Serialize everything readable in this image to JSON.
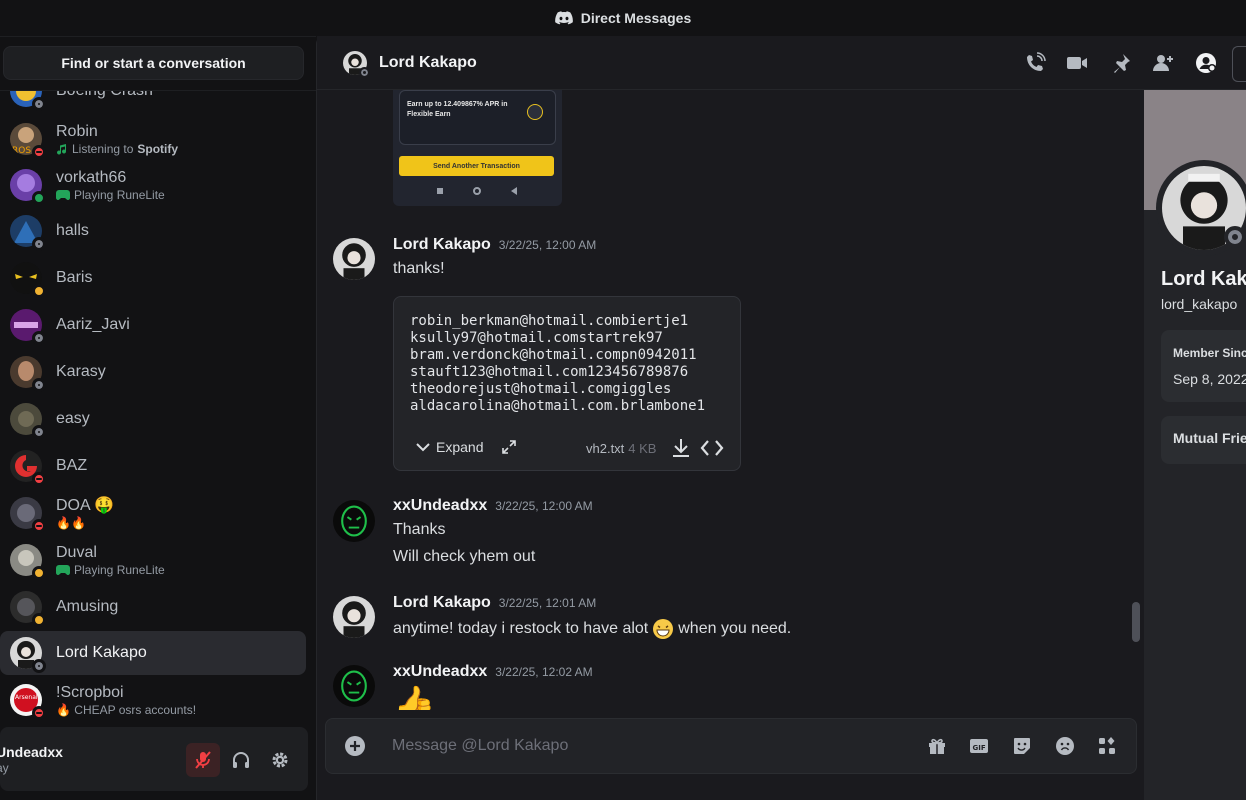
{
  "window": {
    "title": "Direct Messages"
  },
  "sidebar": {
    "search_label": "Find or start a conversation",
    "dms": [
      {
        "name": "Boeing Crash",
        "status": "offline",
        "sub": ""
      },
      {
        "name": "Robin",
        "status": "dnd",
        "sub_prefix": "Listening to",
        "sub": "Spotify",
        "sub_icon": "music-note-icon"
      },
      {
        "name": "vorkath66",
        "status": "online",
        "sub": "Playing RuneLite",
        "sub_icon": "gamepad-icon"
      },
      {
        "name": "halls",
        "status": "offline",
        "sub": ""
      },
      {
        "name": "Baris",
        "status": "idle",
        "sub": ""
      },
      {
        "name": "Aariz_Javi",
        "status": "offline",
        "sub": ""
      },
      {
        "name": "Karasy",
        "status": "offline",
        "sub": ""
      },
      {
        "name": "easy",
        "status": "offline",
        "sub": ""
      },
      {
        "name": "BAZ",
        "status": "dnd",
        "sub": ""
      },
      {
        "name": "DOA 🤑",
        "status": "dnd",
        "sub": "🔥🔥"
      },
      {
        "name": "Duval",
        "status": "idle",
        "sub": "Playing RuneLite",
        "sub_icon": "gamepad-icon"
      },
      {
        "name": "Amusing",
        "status": "idle",
        "sub": ""
      },
      {
        "name": "Lord Kakapo",
        "status": "offline",
        "sub": "",
        "selected": true
      },
      {
        "name": "!Scropboi",
        "status": "dnd",
        "sub": "🔥 CHEAP osrs accounts!"
      }
    ],
    "user_panel": {
      "name": "Undeadxx",
      "status": "ay"
    }
  },
  "chat": {
    "recipient": "Lord Kakapo",
    "image_attachment": {
      "text": "Earn up to 12.409867% APR in Flexible Earn",
      "button": "Send Another Transaction"
    },
    "messages": [
      {
        "author": "Lord Kakapo",
        "time": "3/22/25, 12:00 AM",
        "lines": [
          "thanks!"
        ]
      },
      {
        "author": "xxUndeadxx",
        "time": "3/22/25, 12:00 AM",
        "lines": [
          "Thanks",
          "Will check yhem out"
        ]
      },
      {
        "author": "Lord Kakapo",
        "time": "3/22/25, 12:01 AM",
        "line_before": "anytime! today i restock to have alot",
        "line_after": "when you need."
      },
      {
        "author": "xxUndeadxx",
        "time": "3/22/25, 12:02 AM",
        "lines": [
          "👍"
        ]
      }
    ],
    "file": {
      "content": "robin_berkman@hotmail.combiertje1\nksully97@hotmail.comstartrek97\nbram.verdonck@hotmail.compn0942011\nstauft123@hotmail.com123456789876\ntheodorejust@hotmail.comgiggles\naldacarolina@hotmail.com.brlambone1",
      "expand_label": "Expand",
      "name": "vh2.txt",
      "size": "4 KB"
    },
    "composer_placeholder": "Message @Lord Kakapo"
  },
  "profile": {
    "display_name": "Lord Kak",
    "username": "lord_kakapo",
    "member_since_label": "Member Sinc",
    "member_since_value": "Sep 8, 2022",
    "mutual_label": "Mutual Frie"
  },
  "colors": {
    "accent": "#5865f2",
    "dnd": "#f23f43",
    "online": "#23a55a",
    "idle": "#f0b232",
    "offline": "#80848e"
  }
}
